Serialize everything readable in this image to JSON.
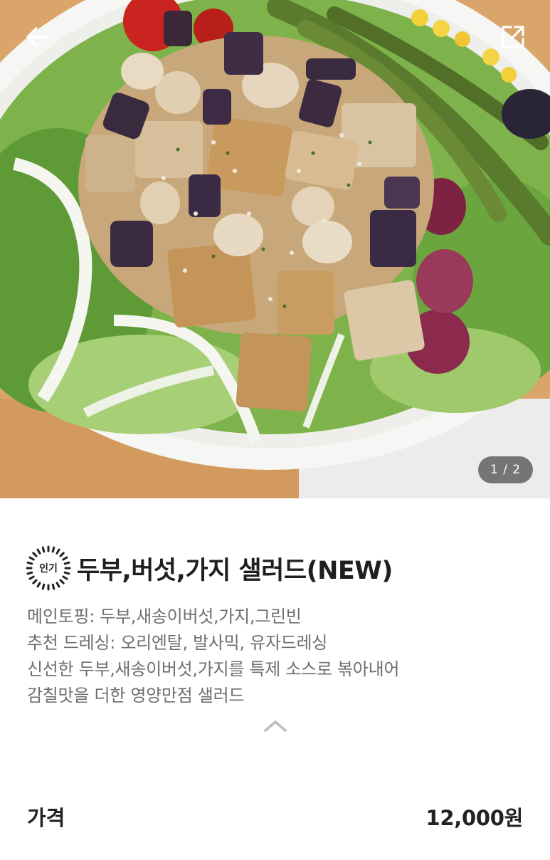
{
  "header": {
    "back_icon": "arrow-left-icon",
    "expand_icon": "expand-icon"
  },
  "gallery": {
    "page_indicator": "1 / 2",
    "current_page": 1,
    "total_pages": 2
  },
  "product": {
    "badge": "인기",
    "title": "두부,버섯,가지 샐러드(NEW)",
    "description_lines": [
      "메인토핑: 두부,새송이버섯,가지,그린빈",
      "추천 드레싱: 오리엔탈, 발사믹, 유자드레싱",
      "신선한 두부,새송이버섯,가지를 특제 소스로 볶아내어",
      "감칠맛을 더한 영양만점 샐러드"
    ],
    "collapse_icon": "chevron-up-icon",
    "price_label": "가격",
    "price_value": "12,000원"
  },
  "colors": {
    "title_text": "#1f1f1f",
    "description_text": "#6f6f6f",
    "indicator_bg": "#464646"
  }
}
